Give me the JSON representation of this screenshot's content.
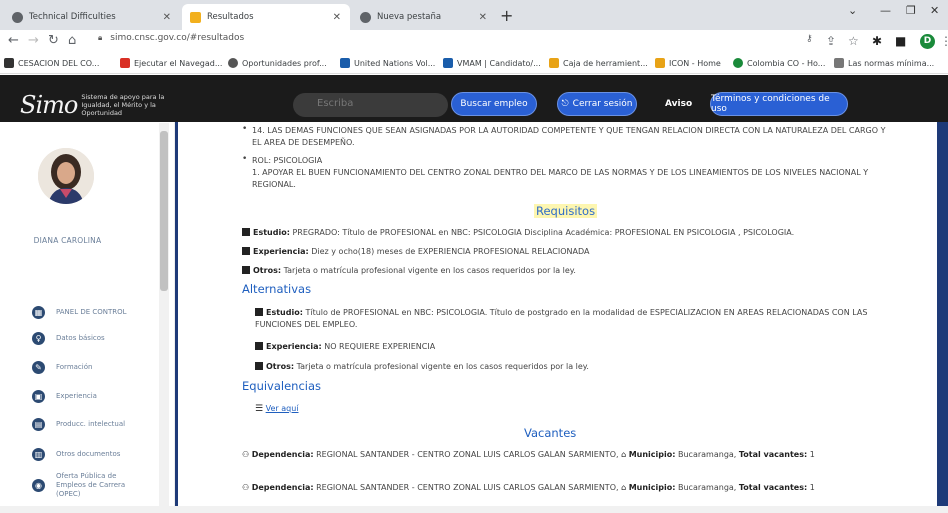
{
  "browser": {
    "tabs": [
      {
        "title": "Technical Difficulties",
        "color": "#5f6368"
      },
      {
        "title": "Resultados",
        "color": "#f2b01e"
      },
      {
        "title": "Nueva pestaña",
        "color": "#5f6368"
      }
    ],
    "url": "simo.cnsc.gov.co/#resultados",
    "bookmarks": [
      {
        "label": "CESACION DEL CO...",
        "color": "#333"
      },
      {
        "label": "Ejecutar el Navegad...",
        "color": "#d93025"
      },
      {
        "label": "Oportunidades prof...",
        "color": "#555"
      },
      {
        "label": "United Nations Vol...",
        "color": "#1a5dab"
      },
      {
        "label": "VMAM | Candidato/...",
        "color": "#1a5dab"
      },
      {
        "label": "Caja de herramient...",
        "color": "#e8a317"
      },
      {
        "label": "ICON - Home",
        "color": "#e8a317"
      },
      {
        "label": "Colombia CO - Ho...",
        "color": "#1a8a3a"
      },
      {
        "label": "Las normas mínima...",
        "color": "#777"
      }
    ],
    "profile_initial": "D"
  },
  "header": {
    "logo_text": "Simo",
    "logo_sub": "Sistema de apoyo para la Igualdad, el Mérito y la Oportunidad",
    "search_placeholder": "Escriba",
    "buscar_label": "Buscar empleo",
    "cerrar_label": "Cerrar sesión",
    "aviso_label": "Aviso",
    "terminos_label": "Términos y condiciones de uso"
  },
  "sidebar": {
    "user_name": "DIANA CAROLINA",
    "items": [
      {
        "label": "PANEL DE CONTROL",
        "icon": "dashboard-icon"
      },
      {
        "label": "Datos básicos",
        "icon": "user-icon"
      },
      {
        "label": "Formación",
        "icon": "graduation-icon"
      },
      {
        "label": "Experiencia",
        "icon": "briefcase-icon"
      },
      {
        "label": "Producc. intelectual",
        "icon": "book-icon"
      },
      {
        "label": "Otros documentos",
        "icon": "document-icon"
      },
      {
        "label": "Oferta Pública de Empleos de Carrera (OPEC)",
        "icon": "globe-icon"
      }
    ]
  },
  "content": {
    "item14": "14. LAS DEMAS FUNCIONES QUE SEAN ASIGNADAS POR LA AUTORIDAD COMPETENTE Y QUE TENGAN RELACION DIRECTA CON LA NATURALEZA DEL CARGO Y EL AREA DE DESEMPEÑO.",
    "rol": "ROL: PSICOLOGIA",
    "rol_item": "1. APOYAR EL BUEN FUNCIONAMIENTO DEL CENTRO ZONAL DENTRO DEL MARCO DE LAS NORMAS Y DE LOS LINEAMIENTOS DE LOS NIVELES NACIONAL Y REGIONAL.",
    "requisitos_title": "Requisitos",
    "estudio_label": "Estudio:",
    "estudio_text": "PREGRADO: Título de PROFESIONAL en NBC: PSICOLOGIA Disciplina Académica: PROFESIONAL EN PSICOLOGIA , PSICOLOGIA.",
    "experiencia_label": "Experiencia:",
    "experiencia_text": "Diez y ocho(18) meses de EXPERIENCIA PROFESIONAL RELACIONADA",
    "otros_label": "Otros:",
    "otros_text": "Tarjeta o matrícula profesional vigente en los casos requeridos por la ley.",
    "alternativas_title": "Alternativas",
    "alt_estudio_label": "Estudio:",
    "alt_estudio_text": "Título de PROFESIONAL en NBC: PSICOLOGIA. Título de postgrado en la modalidad de ESPECIALIZACION EN AREAS RELACIONADAS CON LAS FUNCIONES DEL EMPLEO.",
    "alt_experiencia_label": "Experiencia:",
    "alt_experiencia_text": "NO REQUIERE EXPERIENCIA",
    "alt_otros_label": "Otros:",
    "alt_otros_text": "Tarjeta o matrícula profesional vigente en los casos requeridos por la ley.",
    "equivalencias_title": "Equivalencias",
    "ver_aqui": "Ver aquí",
    "vacantes_title": "Vacantes",
    "vacantes": [
      {
        "dep_label": "Dependencia:",
        "dep": "REGIONAL SANTANDER - CENTRO ZONAL LUIS CARLOS GALAN SARMIENTO,",
        "mun_label": "Municipio:",
        "mun": "Bucaramanga,",
        "total_label": "Total vacantes:",
        "total": "1"
      },
      {
        "dep_label": "Dependencia:",
        "dep": "REGIONAL SANTANDER - CENTRO ZONAL LUIS CARLOS GALAN SARMIENTO,",
        "mun_label": "Municipio:",
        "mun": "Bucaramanga,",
        "total_label": "Total vacantes:",
        "total": "1"
      }
    ]
  }
}
